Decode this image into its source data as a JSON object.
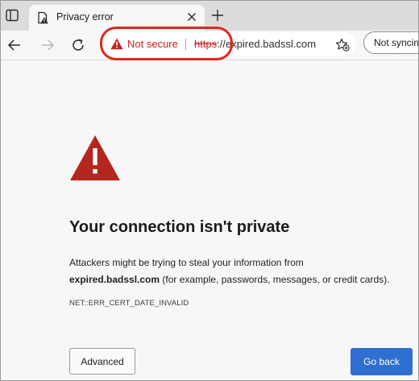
{
  "tab": {
    "title": "Privacy error"
  },
  "addressbar": {
    "security_label": "Not secure",
    "url_scheme": "https",
    "url_rest": "://expired.badssl.com"
  },
  "profile": {
    "label": "Not syncing"
  },
  "page": {
    "heading": "Your connection isn't private",
    "paragraph_prefix": "Attackers might be trying to steal your information from",
    "domain": "expired.badssl.com",
    "paragraph_suffix": " (for example, passwords, messages, or credit cards).",
    "error_code": "NET::ERR_CERT_DATE_INVALID"
  },
  "buttons": {
    "advanced": "Advanced",
    "go_back": "Go back"
  },
  "icons": {
    "tab_actions": "tab-actions-icon",
    "favicon": "warning-document-icon",
    "close": "close-icon",
    "new_tab": "plus-icon",
    "back": "arrow-left-icon",
    "forward": "arrow-right-icon",
    "refresh": "refresh-icon",
    "security": "warning-triangle-icon",
    "favorites": "star-plus-icon",
    "hero": "warning-triangle-icon"
  },
  "colors": {
    "warning_red": "#c5221f",
    "hero_red": "#b5271e",
    "highlight_red": "#e0281b",
    "primary_blue": "#2f6fcf"
  }
}
